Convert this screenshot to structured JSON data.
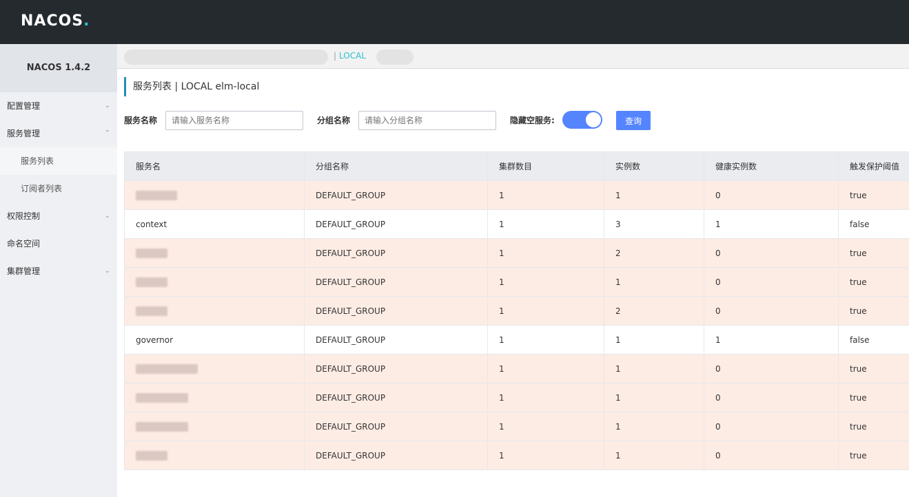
{
  "header": {
    "logo_text": "NACOS",
    "logo_dot": "."
  },
  "sidebar": {
    "version": "NACOS 1.4.2",
    "items": [
      {
        "label": "配置管理",
        "chevron": "⌄"
      },
      {
        "label": "服务管理",
        "chevron": "⌃"
      },
      {
        "label": "服务列表"
      },
      {
        "label": "订阅者列表"
      },
      {
        "label": "权限控制",
        "chevron": "⌄"
      },
      {
        "label": "命名空间"
      },
      {
        "label": "集群管理",
        "chevron": "⌄"
      }
    ]
  },
  "breadcrumb": {
    "separator": "|",
    "current": "LOCAL"
  },
  "page_title": "服务列表 | LOCAL elm-local",
  "filters": {
    "service_label": "服务名称",
    "service_placeholder": "请输入服务名称",
    "group_label": "分组名称",
    "group_placeholder": "请输入分组名称",
    "hide_empty_label": "隐藏空服务:",
    "query_button": "查询"
  },
  "table": {
    "headers": [
      "服务名",
      "分组名称",
      "集群数目",
      "实例数",
      "健康实例数",
      "触发保护阈值"
    ],
    "rows": [
      {
        "name": "",
        "group": "DEFAULT_GROUP",
        "clusters": "1",
        "instances": "1",
        "healthy": "0",
        "protect": "true"
      },
      {
        "name": "context",
        "group": "DEFAULT_GROUP",
        "clusters": "1",
        "instances": "3",
        "healthy": "1",
        "protect": "false"
      },
      {
        "name": "",
        "group": "DEFAULT_GROUP",
        "clusters": "1",
        "instances": "2",
        "healthy": "0",
        "protect": "true"
      },
      {
        "name": "",
        "group": "DEFAULT_GROUP",
        "clusters": "1",
        "instances": "1",
        "healthy": "0",
        "protect": "true"
      },
      {
        "name": "",
        "group": "DEFAULT_GROUP",
        "clusters": "1",
        "instances": "2",
        "healthy": "0",
        "protect": "true"
      },
      {
        "name": "governor",
        "group": "DEFAULT_GROUP",
        "clusters": "1",
        "instances": "1",
        "healthy": "1",
        "protect": "false"
      },
      {
        "name": "",
        "group": "DEFAULT_GROUP",
        "clusters": "1",
        "instances": "1",
        "healthy": "0",
        "protect": "true"
      },
      {
        "name": "",
        "group": "DEFAULT_GROUP",
        "clusters": "1",
        "instances": "1",
        "healthy": "0",
        "protect": "true"
      },
      {
        "name": "",
        "group": "DEFAULT_GROUP",
        "clusters": "1",
        "instances": "1",
        "healthy": "0",
        "protect": "true"
      },
      {
        "name": "",
        "group": "DEFAULT_GROUP",
        "clusters": "1",
        "instances": "1",
        "healthy": "0",
        "protect": "true"
      }
    ]
  },
  "colors": {
    "accent": "#5584ff",
    "warn_row": "#fdece4",
    "header_bg": "#252a2f",
    "logo_accent": "#2ec1cc"
  }
}
